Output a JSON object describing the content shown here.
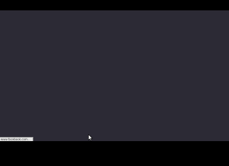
{
  "window": {
    "background_color": "#2c2a35",
    "letterbox_color": "#000000"
  },
  "status_bar": {
    "url": "www.facebook.com..."
  },
  "cursor": {
    "icon": "mouse-pointer-icon"
  }
}
